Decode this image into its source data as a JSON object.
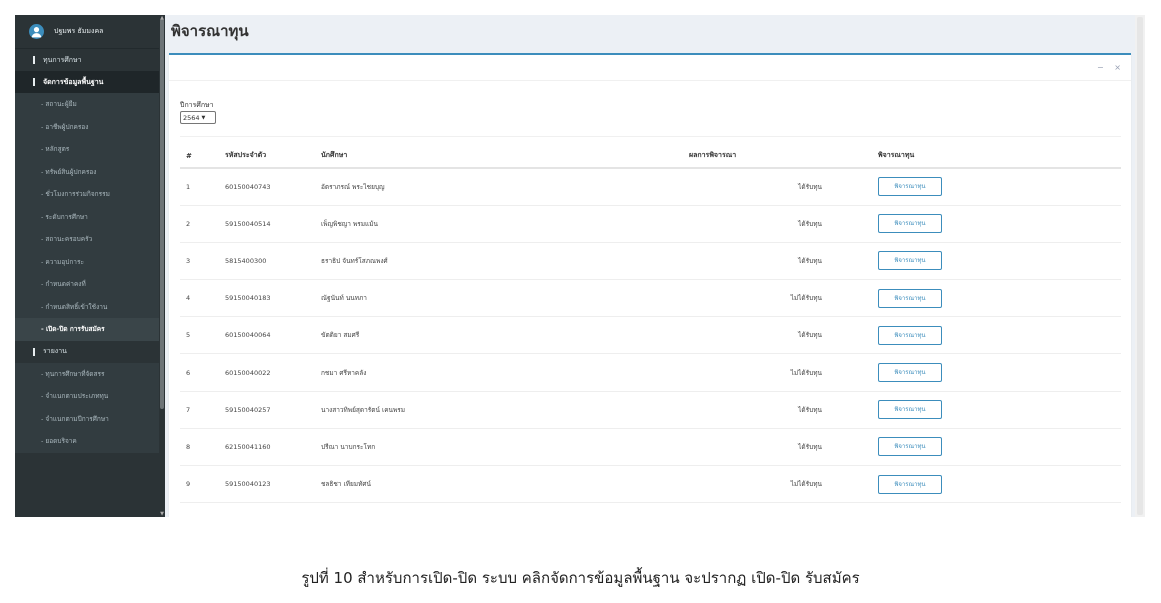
{
  "user": {
    "name": "ปฐมพร ธัมมงคล"
  },
  "sidebar": {
    "sections": [
      {
        "label": "ทุนการศึกษา",
        "active": false,
        "items": []
      },
      {
        "label": "จัดการข้อมูลพื้นฐาน",
        "active": true,
        "items": [
          {
            "label": "- สถานะผู้ยืม",
            "active": false
          },
          {
            "label": "- อาชีพผู้ปกครอง",
            "active": false
          },
          {
            "label": "- หลักสูตร",
            "active": false
          },
          {
            "label": "- ทรัพย์สินผู้ปกครอง",
            "active": false
          },
          {
            "label": "- ชั่วโมงการร่วมกิจกรรม",
            "active": false
          },
          {
            "label": "- ระดับการศึกษา",
            "active": false
          },
          {
            "label": "- สถานะครอบครัว",
            "active": false
          },
          {
            "label": "- ความอุปการะ",
            "active": false
          },
          {
            "label": "- กำหนดค่าคงที่",
            "active": false
          },
          {
            "label": "- กำหนดสิทธิ์เข้าใช้งาน",
            "active": false
          },
          {
            "label": "- เปิด-ปิด การรับสมัคร",
            "active": true
          }
        ]
      },
      {
        "label": "รายงาน",
        "active": false,
        "items": [
          {
            "label": "- ทุนการศึกษาที่จัดสรร",
            "active": false
          },
          {
            "label": "- จำแนกตามประเภททุน",
            "active": false
          },
          {
            "label": "- จำแนกตามปีการศึกษา",
            "active": false
          },
          {
            "label": "- ยอดบริจาค",
            "active": false
          }
        ]
      }
    ]
  },
  "page": {
    "title": "พิจารณาทุน",
    "year_label": "ปีการศึกษา",
    "year_value": "2564",
    "box_tools": {
      "minimize": "−",
      "close": "×"
    }
  },
  "table": {
    "headers": [
      "#",
      "รหัสประจำตัว",
      "นักศึกษา",
      "ผลการพิจารณา",
      "พิจารณาทุน"
    ],
    "button_label": "พิจารณาทุน",
    "rows": [
      {
        "num": "1",
        "id": "60150040743",
        "name": "อัตราภรณ์ พระไชยบุญ",
        "result": "ได้รับทุน"
      },
      {
        "num": "2",
        "id": "59150040514",
        "name": "เพ็ญพิชญา พรมแม้น",
        "result": "ได้รับทุน"
      },
      {
        "num": "3",
        "id": "5815400300",
        "name": "ธราธิป จันทร์โสภณพงศ์",
        "result": "ได้รับทุน"
      },
      {
        "num": "4",
        "id": "59150040183",
        "name": "ณัฐนันท์ นนทภา",
        "result": "ไม่ได้รับทุน"
      },
      {
        "num": "5",
        "id": "60150040064",
        "name": "ขัตติยา สมศรี",
        "result": "ได้รับทุน"
      },
      {
        "num": "6",
        "id": "60150040022",
        "name": "กชมา ศรีหาคลัง",
        "result": "ไม่ได้รับทุน"
      },
      {
        "num": "7",
        "id": "59150040257",
        "name": "นางสาวทิพย์สุดารัตน์ เคนพรม",
        "result": "ได้รับทุน"
      },
      {
        "num": "8",
        "id": "62150041160",
        "name": "ปรีณา นาบกระโทก",
        "result": "ได้รับทุน"
      },
      {
        "num": "9",
        "id": "59150040123",
        "name": "ชลธิชา เทียมทัศน์",
        "result": "ไม่ได้รับทุน"
      }
    ]
  },
  "caption": "รูปที่ 10 สำหรับการเปิด-ปิด ระบบ คลิกจัดการข้อมูลพื้นฐาน จะปรากฏ เปิด-ปิด รับสมัคร",
  "colors": {
    "accent": "#3c8dbc",
    "sidebar": "#2b3336"
  }
}
